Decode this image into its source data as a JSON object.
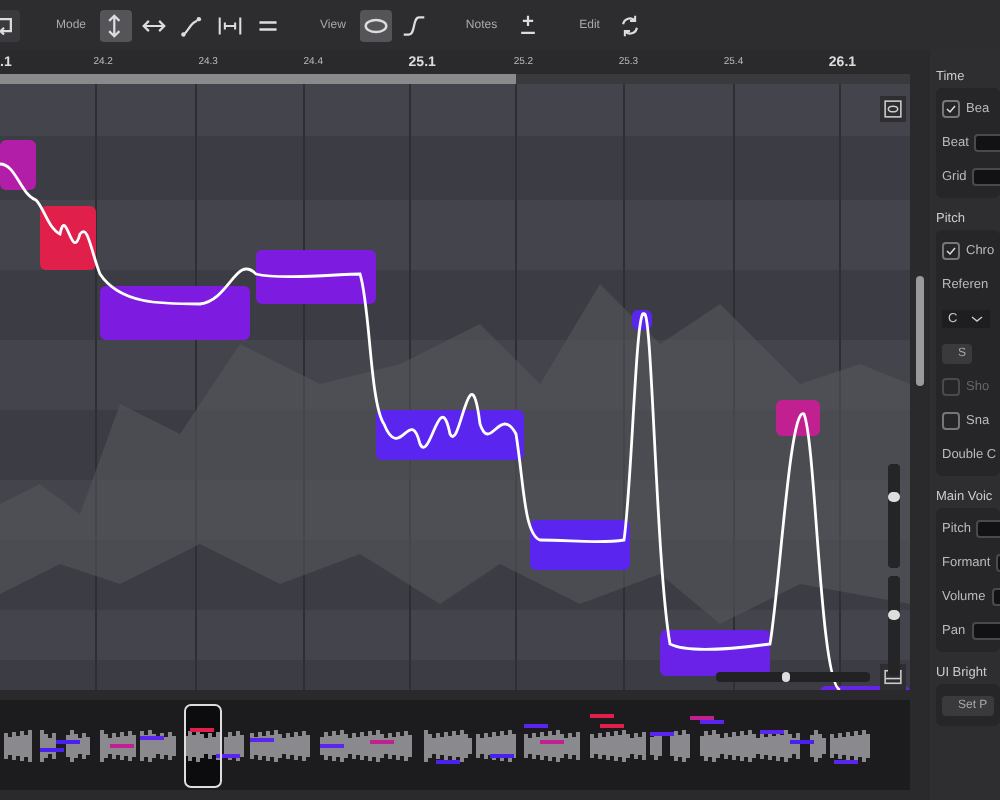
{
  "toolbar": {
    "groups": [
      {
        "label": "Mode",
        "tools": [
          {
            "kind": "updown",
            "selected": true
          },
          {
            "kind": "leftright",
            "selected": false
          },
          {
            "kind": "line",
            "selected": false
          },
          {
            "kind": "bracket",
            "selected": false
          },
          {
            "kind": "equals",
            "selected": false
          }
        ]
      },
      {
        "label": "View",
        "tools": [
          {
            "kind": "ellipse",
            "selected": true
          },
          {
            "kind": "scurve",
            "selected": false
          }
        ]
      },
      {
        "label": "Notes",
        "tools": [
          {
            "kind": "plusminus",
            "selected": false
          }
        ]
      },
      {
        "label": "Edit",
        "tools": [
          {
            "kind": "loop",
            "selected": false
          }
        ]
      }
    ]
  },
  "ruler": [
    {
      "label": ".1",
      "major": true
    },
    {
      "label": "24.2",
      "major": false
    },
    {
      "label": "24.3",
      "major": false
    },
    {
      "label": "24.4",
      "major": false
    },
    {
      "label": "25.1",
      "major": true
    },
    {
      "label": "25.2",
      "major": false
    },
    {
      "label": "25.3",
      "major": false
    },
    {
      "label": "25.4",
      "major": false
    },
    {
      "label": "26.1",
      "major": true
    }
  ],
  "editor": {
    "vertical_sliders": [
      {
        "level": 0.7
      },
      {
        "level": 0.62
      }
    ],
    "horizontal_slider": {
      "level": 0.45
    }
  },
  "panel": [
    {
      "kind": "section",
      "label": "Time"
    },
    {
      "kind": "checkbox",
      "label": "Bea",
      "checked": true,
      "disabled": false
    },
    {
      "kind": "field",
      "label": "Beat"
    },
    {
      "kind": "field",
      "label": "Grid"
    },
    {
      "kind": "section",
      "label": "Pitch"
    },
    {
      "kind": "checkbox",
      "label": "Chro",
      "checked": true,
      "disabled": false
    },
    {
      "kind": "text",
      "label": "Referen"
    },
    {
      "kind": "dropdown",
      "label": "C"
    },
    {
      "kind": "button",
      "label": "S"
    },
    {
      "kind": "checkbox",
      "label": "Sho",
      "checked": false,
      "disabled": true
    },
    {
      "kind": "checkbox",
      "label": "Sna",
      "checked": false,
      "disabled": false
    },
    {
      "kind": "text",
      "label": "Double C"
    },
    {
      "kind": "section",
      "label": "Main Voic"
    },
    {
      "kind": "field",
      "label": "Pitch"
    },
    {
      "kind": "field",
      "label": "Formant"
    },
    {
      "kind": "field",
      "label": "Volume"
    },
    {
      "kind": "field",
      "label": "Pan"
    },
    {
      "kind": "section",
      "label": "UI Bright"
    },
    {
      "kind": "button",
      "label": "Set P"
    }
  ]
}
